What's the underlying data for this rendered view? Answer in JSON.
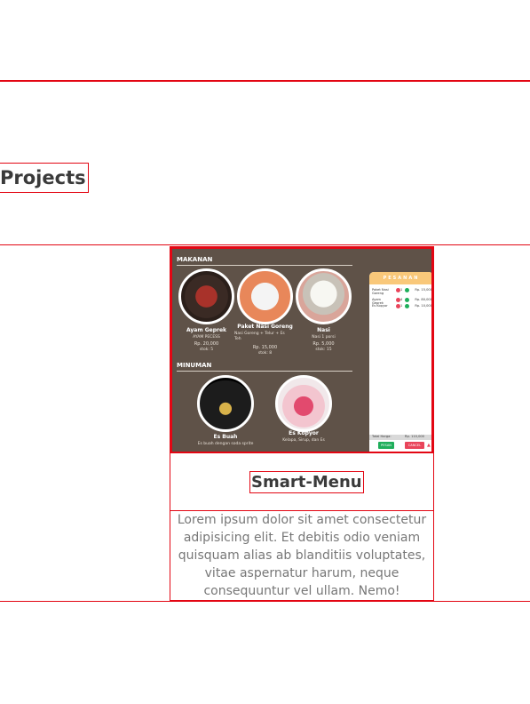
{
  "section": {
    "title": "Projects"
  },
  "project": {
    "title": "Smart-Menu",
    "description": "Lorem ipsum dolor sit amet consectetur adipisicing elit. Et debitis odio veniam quisquam alias ab blanditiis voluptates, vitae aspernatur harum, neque consequuntur vel ullam. Nemo!"
  },
  "preview": {
    "makanan_heading": "MAKANAN",
    "minuman_heading": "MINUMAN",
    "foods": [
      {
        "name": "Ayam Geprek",
        "desc": "AYAM PECESS",
        "price": "Rp. 20,000",
        "stock": "stok: 5"
      },
      {
        "name": "Paket Nasi Goreng",
        "desc": "Nasi Goreng + Telur + Es Teh",
        "price": "Rp. 15,000",
        "stock": "stok: 8"
      },
      {
        "name": "Nasi",
        "desc": "Nasi 1 porsi",
        "price": "Rp. 5,000",
        "stock": "stok: 15"
      }
    ],
    "drinks": [
      {
        "name": "Es Buah",
        "desc": "Es buah dengan soda sprite"
      },
      {
        "name": "Es Kopyor",
        "desc": "Kelapa, Sirup, dan Es"
      }
    ],
    "order": {
      "title": "PESANAN",
      "items": [
        {
          "name": "Paket Nasi Goreng",
          "qty": "1",
          "price": "Rp. 15,000"
        },
        {
          "name": "Ayam Geprek",
          "qty": "4",
          "price": "Rp. 80,000"
        },
        {
          "name": "Es Kopyor",
          "qty": "1",
          "price": "Rp. 10,000"
        }
      ],
      "total_label": "Total Harga:",
      "total_value": "Rp. 110,000",
      "pesan_label": "PESAN",
      "cancel_label": "CANCEL"
    },
    "colors": {
      "panel": "#5f5248",
      "order_header": "#f9c87a",
      "pesan": "#1fae5b",
      "cancel": "#e9445a"
    }
  },
  "colors": {
    "accent_border": "#e30613",
    "text": "#3a3a3a",
    "muted": "#777777"
  }
}
